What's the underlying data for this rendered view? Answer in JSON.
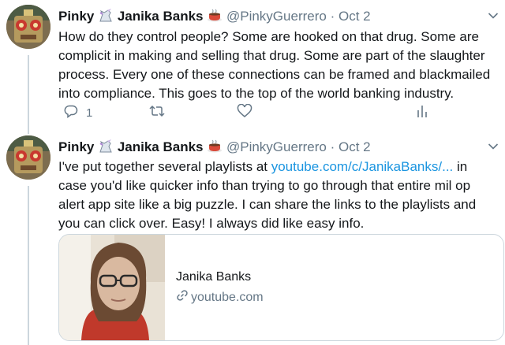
{
  "tweets": [
    {
      "display_name": "Pinky",
      "display_name_2": "Janika Banks",
      "handle": "@PinkyGuerrero",
      "separator": "·",
      "time": "Oct 2",
      "text": "How do they control people? Some are hooked on that drug. Some are complicit in making and selling that drug. Some are part of the slaughter process. Every one of these connections can be framed and blackmailed into compliance. This goes to the top of the world banking industry.",
      "reply_count": "1",
      "retweet_count": "",
      "like_count": ""
    },
    {
      "display_name": "Pinky",
      "display_name_2": "Janika Banks",
      "handle": "@PinkyGuerrero",
      "separator": "·",
      "time": "Oct 2",
      "text_before": "I've put together several playlists at ",
      "link": "youtube.com/c/JanikaBanks/...",
      "text_after": " in case you'd like quicker info than trying to go through that entire mil op alert app site like a big puzzle. I can share the links to the playlists and you can click over. Easy! I always did like easy info.",
      "card": {
        "title": "Janika Banks",
        "domain": "youtube.com"
      }
    }
  ],
  "icons": [
    "unicorn-emoji",
    "coffee-emoji",
    "chevron-down-icon",
    "reply-icon",
    "retweet-icon",
    "like-icon",
    "analytics-icon",
    "link-icon"
  ],
  "colors": {
    "link": "#1b95e0",
    "muted": "#657786",
    "text": "#14171a",
    "border": "#ccd6dd"
  }
}
